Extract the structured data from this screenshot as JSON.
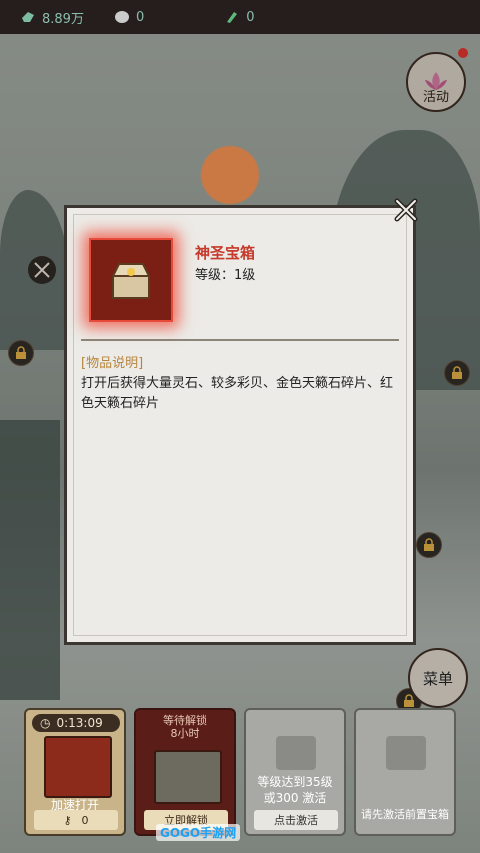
{
  "resources": [
    {
      "icon": "jade-stone-icon",
      "value": "8.89万"
    },
    {
      "icon": "shell-icon",
      "value": "0"
    },
    {
      "icon": "green-crystal-icon",
      "value": "0"
    }
  ],
  "activity": {
    "label": "活动"
  },
  "menu": {
    "label": "菜单"
  },
  "dialog": {
    "item_name": "神圣宝箱",
    "item_level": "等级：1级",
    "desc_title": "[物品说明]",
    "desc_text": "打开后获得大量灵石、较多彩贝、金色天籁石碎片、红色天籁石碎片"
  },
  "slots": [
    {
      "timer": "0:13:09",
      "label": "加速打开",
      "button": "0"
    },
    {
      "wait": "等待解锁\n8小时",
      "button": "立即解锁"
    },
    {
      "label": "等级达到35级\n或300   激活",
      "button": "点击激活"
    },
    {
      "label": "请先激活前置宝箱"
    }
  ],
  "watermark": "GOGO手游网",
  "colors": {
    "accent": "#c63a2b",
    "desc_title": "#b6853c",
    "resource_text": "#9fd8c5"
  }
}
